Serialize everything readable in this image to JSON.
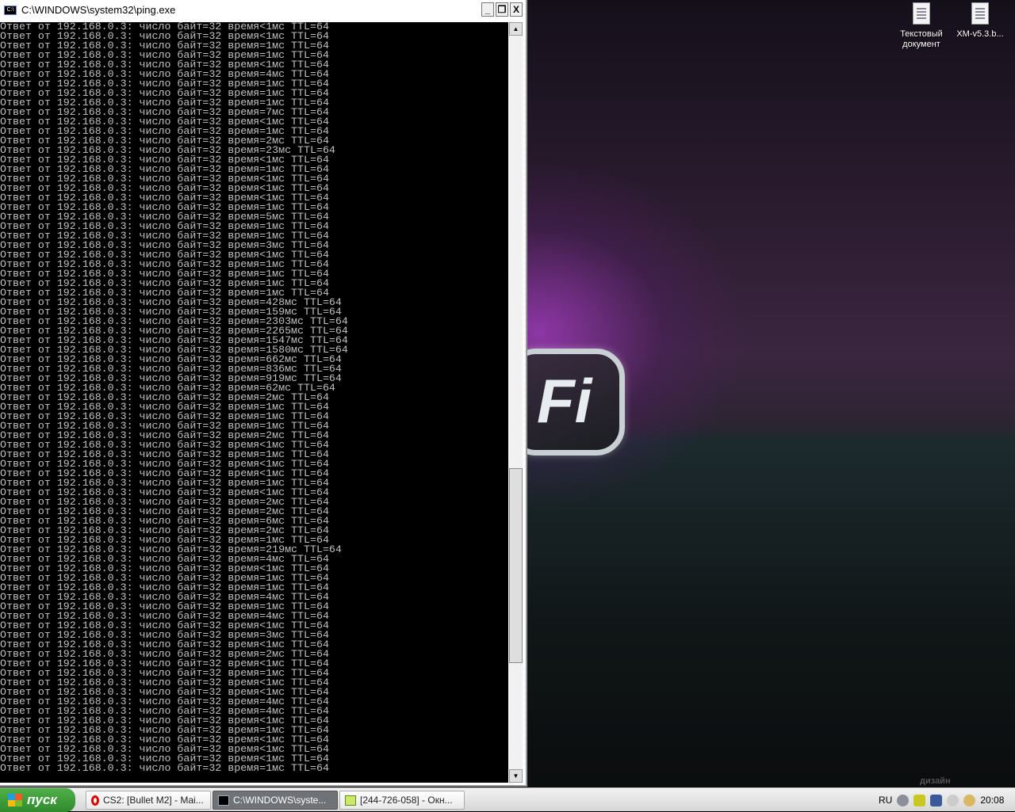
{
  "window": {
    "title": "C:\\WINDOWS\\system32\\ping.exe",
    "minimize": "_",
    "restore": "❐",
    "close": "X"
  },
  "console_lines": [
    "Ответ от 192.168.0.3: число байт=32 время<1мс TTL=64",
    "Ответ от 192.168.0.3: число байт=32 время<1мс TTL=64",
    "Ответ от 192.168.0.3: число байт=32 время=1мс TTL=64",
    "Ответ от 192.168.0.3: число байт=32 время=1мс TTL=64",
    "Ответ от 192.168.0.3: число байт=32 время<1мс TTL=64",
    "Ответ от 192.168.0.3: число байт=32 время=4мс TTL=64",
    "Ответ от 192.168.0.3: число байт=32 время=1мс TTL=64",
    "Ответ от 192.168.0.3: число байт=32 время=1мс TTL=64",
    "Ответ от 192.168.0.3: число байт=32 время=1мс TTL=64",
    "Ответ от 192.168.0.3: число байт=32 время=7мс TTL=64",
    "Ответ от 192.168.0.3: число байт=32 время<1мс TTL=64",
    "Ответ от 192.168.0.3: число байт=32 время=1мс TTL=64",
    "Ответ от 192.168.0.3: число байт=32 время=2мс TTL=64",
    "Ответ от 192.168.0.3: число байт=32 время=23мс TTL=64",
    "Ответ от 192.168.0.3: число байт=32 время<1мс TTL=64",
    "Ответ от 192.168.0.3: число байт=32 время=1мс TTL=64",
    "Ответ от 192.168.0.3: число байт=32 время<1мс TTL=64",
    "Ответ от 192.168.0.3: число байт=32 время<1мс TTL=64",
    "Ответ от 192.168.0.3: число байт=32 время<1мс TTL=64",
    "Ответ от 192.168.0.3: число байт=32 время=1мс TTL=64",
    "Ответ от 192.168.0.3: число байт=32 время=5мс TTL=64",
    "Ответ от 192.168.0.3: число байт=32 время=1мс TTL=64",
    "Ответ от 192.168.0.3: число байт=32 время=1мс TTL=64",
    "Ответ от 192.168.0.3: число байт=32 время=3мс TTL=64",
    "Ответ от 192.168.0.3: число байт=32 время<1мс TTL=64",
    "Ответ от 192.168.0.3: число байт=32 время=1мс TTL=64",
    "Ответ от 192.168.0.3: число байт=32 время=1мс TTL=64",
    "Ответ от 192.168.0.3: число байт=32 время=1мс TTL=64",
    "Ответ от 192.168.0.3: число байт=32 время=1мс TTL=64",
    "Ответ от 192.168.0.3: число байт=32 время=428мс TTL=64",
    "Ответ от 192.168.0.3: число байт=32 время=159мс TTL=64",
    "Ответ от 192.168.0.3: число байт=32 время=2303мс TTL=64",
    "Ответ от 192.168.0.3: число байт=32 время=2265мс TTL=64",
    "Ответ от 192.168.0.3: число байт=32 время=1547мс TTL=64",
    "Ответ от 192.168.0.3: число байт=32 время=1580мс TTL=64",
    "Ответ от 192.168.0.3: число байт=32 время=662мс TTL=64",
    "Ответ от 192.168.0.3: число байт=32 время=836мс TTL=64",
    "Ответ от 192.168.0.3: число байт=32 время=919мс TTL=64",
    "Ответ от 192.168.0.3: число байт=32 время=62мс TTL=64",
    "Ответ от 192.168.0.3: число байт=32 время=2мс TTL=64",
    "Ответ от 192.168.0.3: число байт=32 время=1мс TTL=64",
    "Ответ от 192.168.0.3: число байт=32 время=1мс TTL=64",
    "Ответ от 192.168.0.3: число байт=32 время=1мс TTL=64",
    "Ответ от 192.168.0.3: число байт=32 время=2мс TTL=64",
    "Ответ от 192.168.0.3: число байт=32 время<1мс TTL=64",
    "Ответ от 192.168.0.3: число байт=32 время=1мс TTL=64",
    "Ответ от 192.168.0.3: число байт=32 время<1мс TTL=64",
    "Ответ от 192.168.0.3: число байт=32 время<1мс TTL=64",
    "Ответ от 192.168.0.3: число байт=32 время=1мс TTL=64",
    "Ответ от 192.168.0.3: число байт=32 время<1мс TTL=64",
    "Ответ от 192.168.0.3: число байт=32 время=2мс TTL=64",
    "Ответ от 192.168.0.3: число байт=32 время=2мс TTL=64",
    "Ответ от 192.168.0.3: число байт=32 время=6мс TTL=64",
    "Ответ от 192.168.0.3: число байт=32 время=2мс TTL=64",
    "Ответ от 192.168.0.3: число байт=32 время=1мс TTL=64",
    "Ответ от 192.168.0.3: число байт=32 время=219мс TTL=64",
    "Ответ от 192.168.0.3: число байт=32 время=4мс TTL=64",
    "Ответ от 192.168.0.3: число байт=32 время<1мс TTL=64",
    "Ответ от 192.168.0.3: число байт=32 время=1мс TTL=64",
    "Ответ от 192.168.0.3: число байт=32 время=1мс TTL=64",
    "Ответ от 192.168.0.3: число байт=32 время=4мс TTL=64",
    "Ответ от 192.168.0.3: число байт=32 время=1мс TTL=64",
    "Ответ от 192.168.0.3: число байт=32 время=4мс TTL=64",
    "Ответ от 192.168.0.3: число байт=32 время<1мс TTL=64",
    "Ответ от 192.168.0.3: число байт=32 время=3мс TTL=64",
    "Ответ от 192.168.0.3: число байт=32 время<1мс TTL=64",
    "Ответ от 192.168.0.3: число байт=32 время=2мс TTL=64",
    "Ответ от 192.168.0.3: число байт=32 время<1мс TTL=64",
    "Ответ от 192.168.0.3: число байт=32 время=1мс TTL=64",
    "Ответ от 192.168.0.3: число байт=32 время<1мс TTL=64",
    "Ответ от 192.168.0.3: число байт=32 время<1мс TTL=64",
    "Ответ от 192.168.0.3: число байт=32 время=4мс TTL=64",
    "Ответ от 192.168.0.3: число байт=32 время=4мс TTL=64",
    "Ответ от 192.168.0.3: число байт=32 время<1мс TTL=64",
    "Ответ от 192.168.0.3: число байт=32 время=1мс TTL=64",
    "Ответ от 192.168.0.3: число байт=32 время<1мс TTL=64",
    "Ответ от 192.168.0.3: число байт=32 время<1мс TTL=64",
    "Ответ от 192.168.0.3: число байт=32 время<1мс TTL=64",
    "Ответ от 192.168.0.3: число байт=32 время=1мс TTL=64"
  ],
  "desktop": {
    "icons": [
      {
        "label": "Текстовый документ"
      },
      {
        "label": "XM-v5.3.b..."
      }
    ],
    "wallpaper_text": "Fi",
    "watermark": "дизайн"
  },
  "taskbar": {
    "start_label": "пуск",
    "tasks": [
      {
        "label": "CS2: [Bullet M2] - Mai..."
      },
      {
        "label": "C:\\WINDOWS\\syste..."
      },
      {
        "label": "[244-726-058] - Окн..."
      }
    ],
    "language": "RU",
    "clock": "20:08"
  }
}
